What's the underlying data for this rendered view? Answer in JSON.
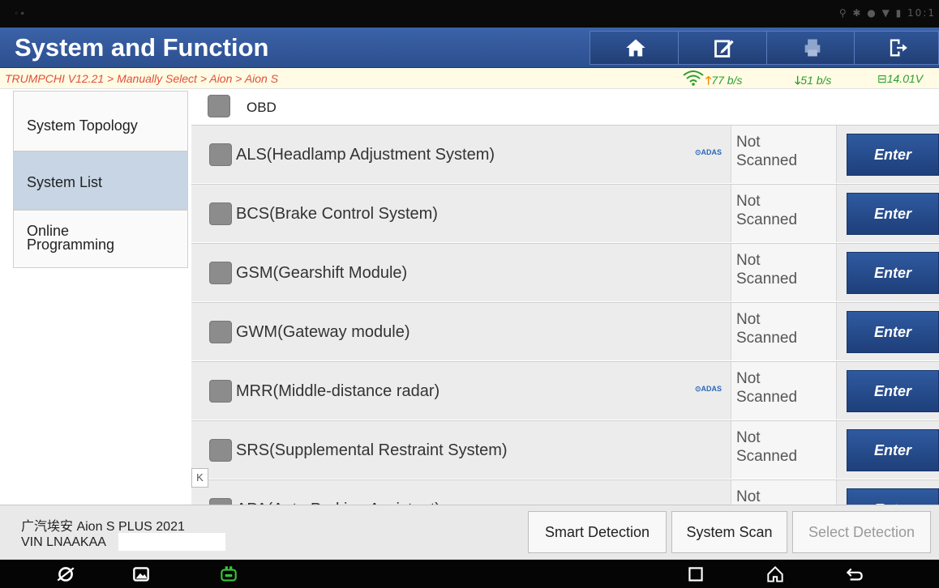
{
  "status_bar": {
    "left_icons": "◦ ▪",
    "right_text": "⚲ ✱ ● ▼ ▮ 10:1"
  },
  "header": {
    "title": "System and Function",
    "buttons": [
      {
        "icon": "home-icon"
      },
      {
        "icon": "edit-report-icon"
      },
      {
        "icon": "print-icon"
      },
      {
        "icon": "exit-icon"
      }
    ]
  },
  "breadcrumb": {
    "path": "TRUMPCHI V12.21 > Manually Select > Aion > Aion S",
    "upload_rate": "77 b/s",
    "download_rate": "51 b/s",
    "voltage": "14.01V"
  },
  "sidebar": {
    "items": [
      {
        "label": "System Topology",
        "active": false
      },
      {
        "label": "System List",
        "active": true
      },
      {
        "label": "Online\nProgramming",
        "active": false
      }
    ]
  },
  "list": {
    "header_label": "OBD",
    "adas_tag": "⊙ADAS",
    "status_line1": "Not",
    "status_line2": "Scanned",
    "enter_label": "Enter",
    "rows": [
      {
        "label": "ALS(Headlamp Adjustment System)",
        "adas": true
      },
      {
        "label": "BCS(Brake Control System)",
        "adas": false
      },
      {
        "label": "GSM(Gearshift Module)",
        "adas": false
      },
      {
        "label": "GWM(Gateway module)",
        "adas": false
      },
      {
        "label": "MRR(Middle-distance radar)",
        "adas": true
      },
      {
        "label": "SRS(Supplemental Restraint System)",
        "adas": false
      },
      {
        "label": "APA(Auto Parking Assistant)",
        "adas": false
      }
    ]
  },
  "collapse_label": "K",
  "footer": {
    "vehicle": "广汽埃安 Aion S PLUS 2021",
    "vin": "VIN LNAAKAA",
    "buttons": [
      {
        "label": "Smart Detection",
        "enabled": true
      },
      {
        "label": "System Scan",
        "enabled": true
      },
      {
        "label": "Select Detection",
        "enabled": false
      }
    ]
  },
  "navbar": {
    "icons": [
      "browser-icon",
      "gallery-icon",
      "vci-icon",
      "recent-apps-icon",
      "home-nav-icon",
      "back-icon"
    ]
  },
  "colors": {
    "header_blue": "#2c4f8f",
    "enter_button": "#1e3f7a",
    "breadcrumb_text": "#e24e3a",
    "rate_text": "#2e9d2e",
    "active_side": "#c7d5e4"
  }
}
